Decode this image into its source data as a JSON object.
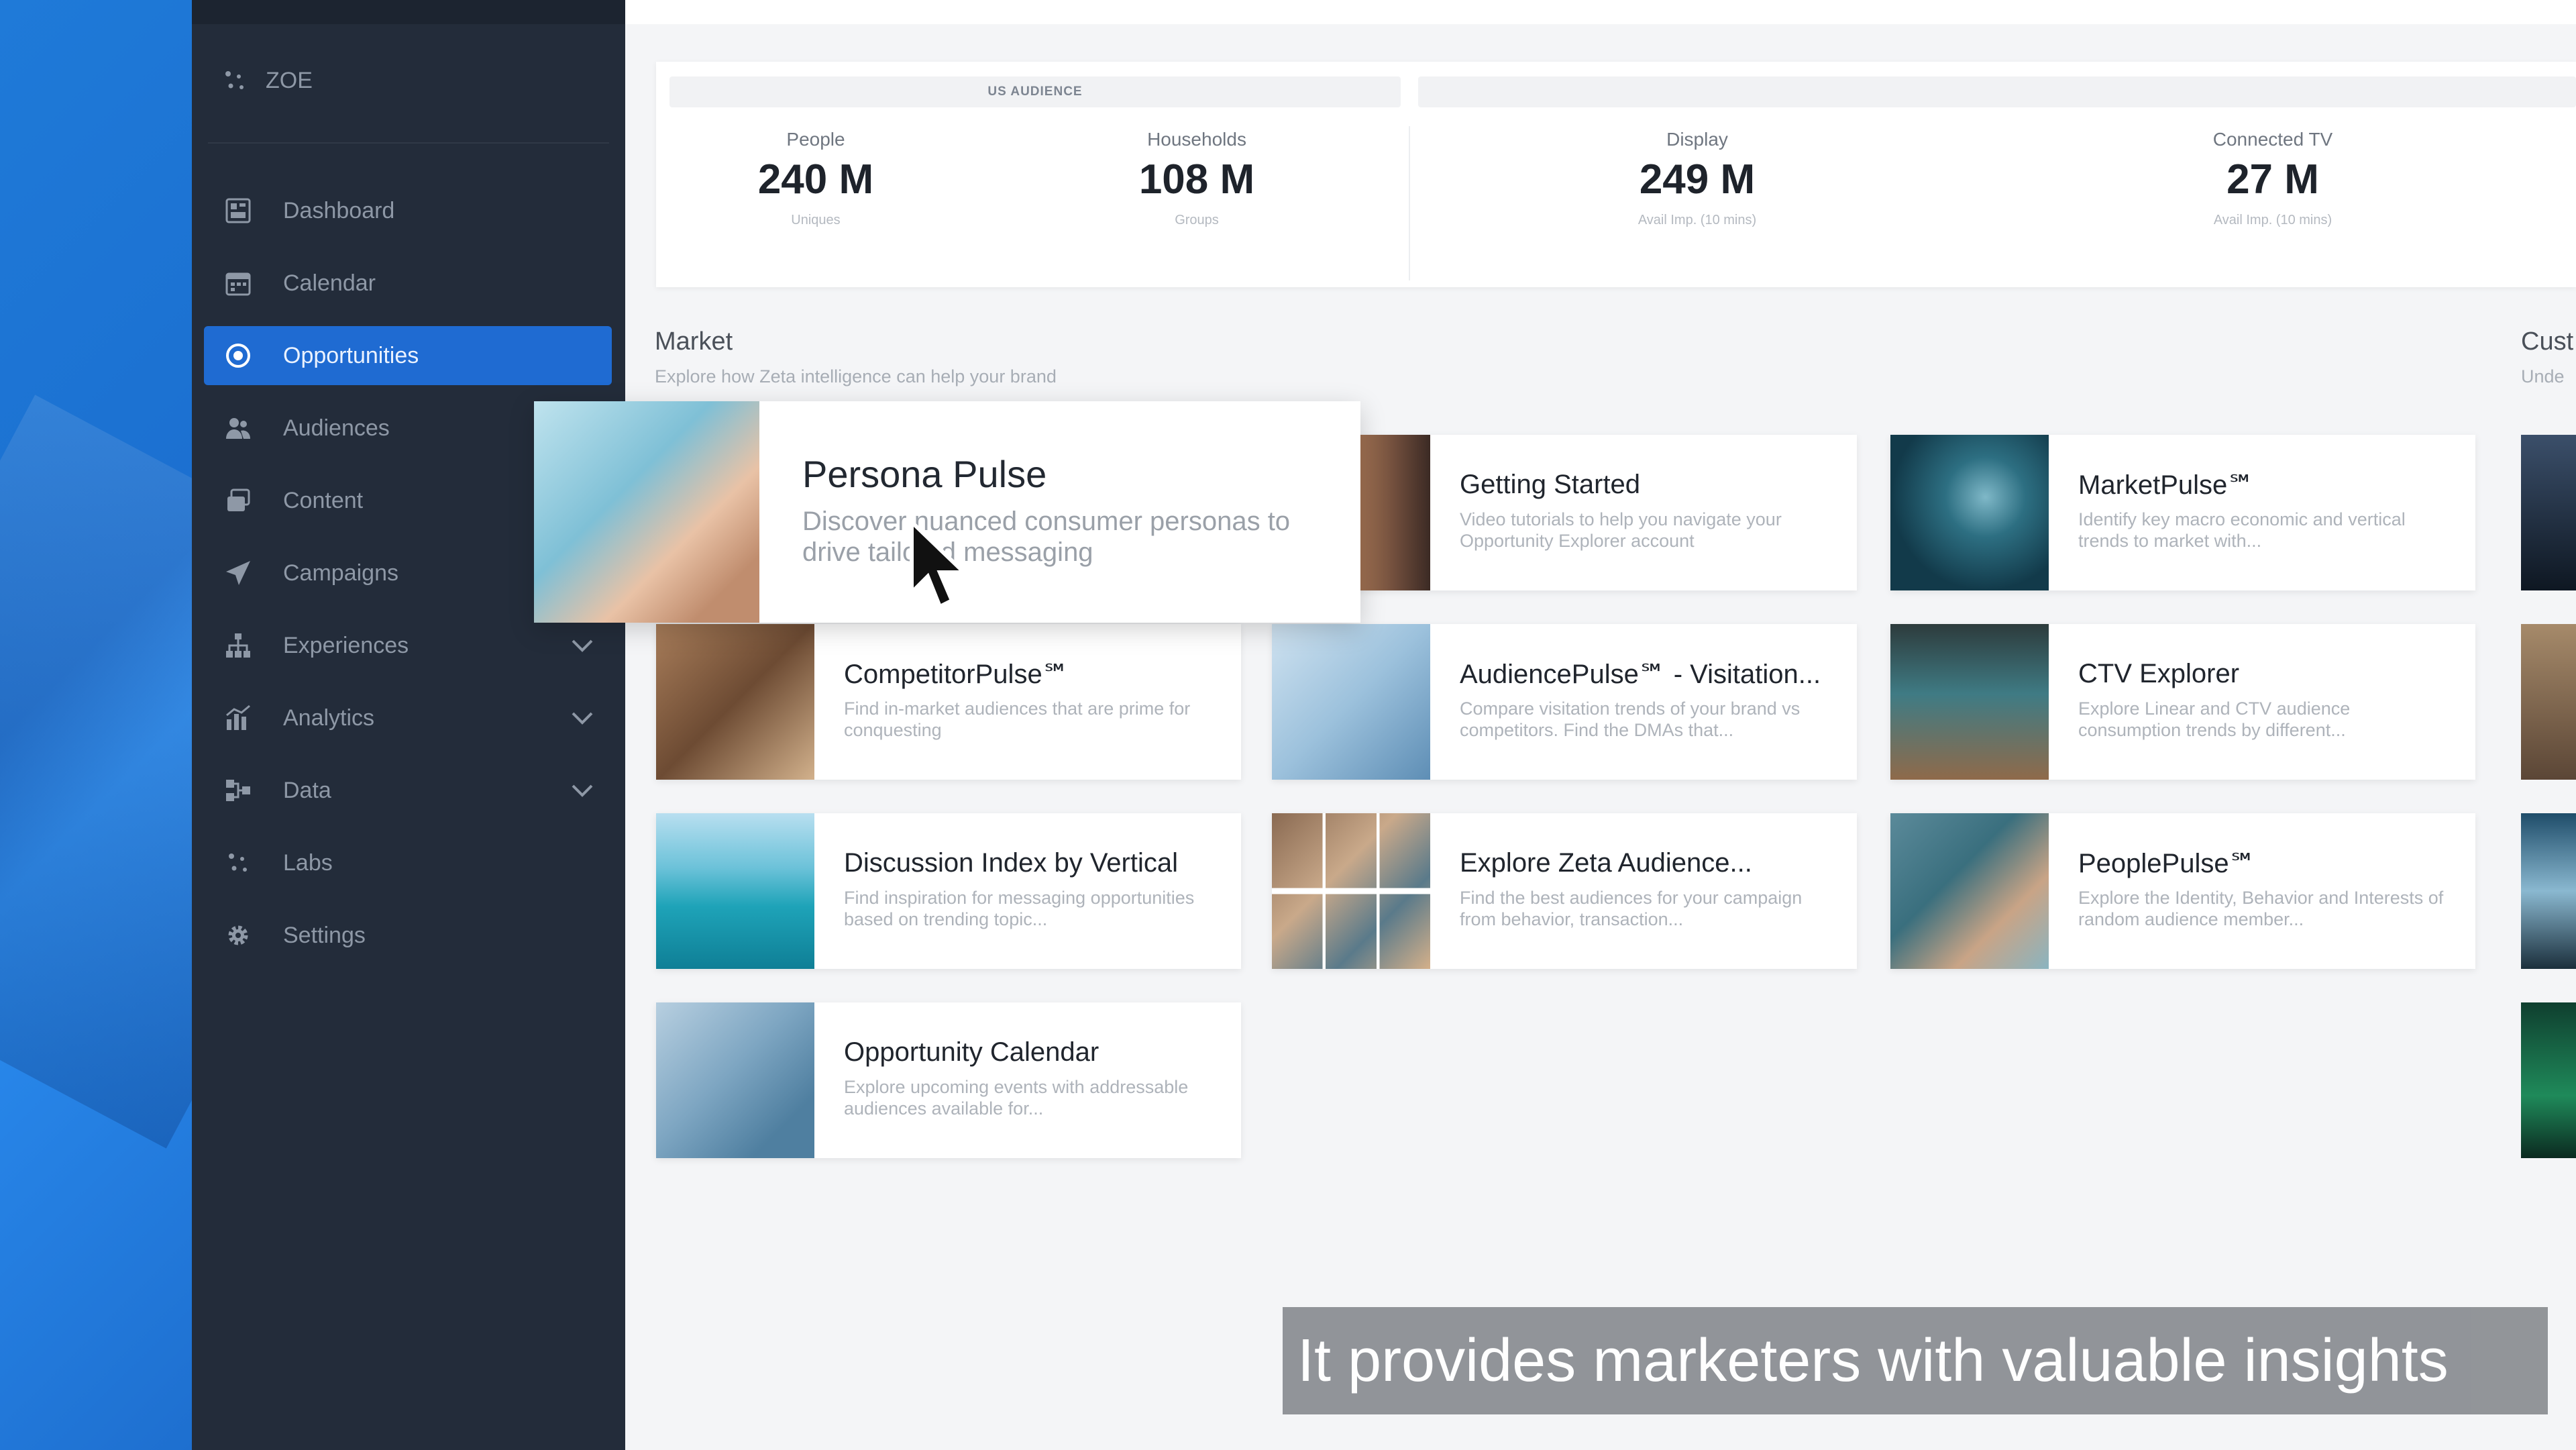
{
  "app": {
    "brand": "ZOE"
  },
  "sidebar": {
    "items": [
      {
        "label": "Dashboard",
        "icon": "dashboard-icon",
        "active": false,
        "expandable": false
      },
      {
        "label": "Calendar",
        "icon": "calendar-icon",
        "active": false,
        "expandable": false
      },
      {
        "label": "Opportunities",
        "icon": "target-icon",
        "active": true,
        "expandable": false
      },
      {
        "label": "Audiences",
        "icon": "audiences-icon",
        "active": false,
        "expandable": false
      },
      {
        "label": "Content",
        "icon": "content-icon",
        "active": false,
        "expandable": false
      },
      {
        "label": "Campaigns",
        "icon": "send-icon",
        "active": false,
        "expandable": false
      },
      {
        "label": "Experiences",
        "icon": "sitemap-icon",
        "active": false,
        "expandable": true
      },
      {
        "label": "Analytics",
        "icon": "analytics-icon",
        "active": false,
        "expandable": true
      },
      {
        "label": "Data",
        "icon": "data-icon",
        "active": false,
        "expandable": true
      },
      {
        "label": "Labs",
        "icon": "labs-icon",
        "active": false,
        "expandable": false
      },
      {
        "label": "Settings",
        "icon": "gear-icon",
        "active": false,
        "expandable": false
      }
    ]
  },
  "stats": {
    "header": "US AUDIENCE",
    "items": [
      {
        "label": "People",
        "value": "240 M",
        "sub": "Uniques"
      },
      {
        "label": "Households",
        "value": "108 M",
        "sub": "Groups"
      },
      {
        "label": "Display",
        "value": "249 M",
        "sub": "Avail Imp. (10 mins)"
      },
      {
        "label": "Connected TV",
        "value": "27 M",
        "sub": "Avail Imp. (10 mins)"
      }
    ]
  },
  "market": {
    "title": "Market",
    "subtitle": "Explore how Zeta intelligence can help your brand"
  },
  "customer": {
    "title": "Cust",
    "subtitle": "Unde"
  },
  "popup": {
    "title": "Persona Pulse",
    "description": "Discover nuanced consumer personas to drive tailored messaging"
  },
  "cards": [
    {
      "title": "Getting Started",
      "description": "Video tutorials to help you navigate your Opportunity Explorer account"
    },
    {
      "title": "MarketPulse℠",
      "description": "Identify key macro economic and vertical trends to market with..."
    },
    {
      "title": "CompetitorPulse℠",
      "description": "Find in-market audiences that are prime for conquesting"
    },
    {
      "title": "AudiencePulse℠ - Visitation...",
      "description": "Compare visitation trends of your brand vs competitors. Find the DMAs that..."
    },
    {
      "title": "CTV Explorer",
      "description": "Explore Linear and CTV audience consumption trends by different..."
    },
    {
      "title": "Discussion Index by Vertical",
      "description": "Find inspiration for messaging opportunities based on trending topic..."
    },
    {
      "title": "Explore Zeta Audience...",
      "description": "Find the best audiences for your campaign from behavior, transaction..."
    },
    {
      "title": "PeoplePulse℠",
      "description": "Explore the Identity, Behavior and Interests of random audience member..."
    },
    {
      "title": "Opportunity Calendar",
      "description": "Explore upcoming events with addressable audiences available for..."
    }
  ],
  "caption": "It provides marketers with valuable insights",
  "colors": {
    "accent": "#1f6bd2",
    "sidebar": "#232c3a",
    "caption_bg": "#8c8f94"
  }
}
